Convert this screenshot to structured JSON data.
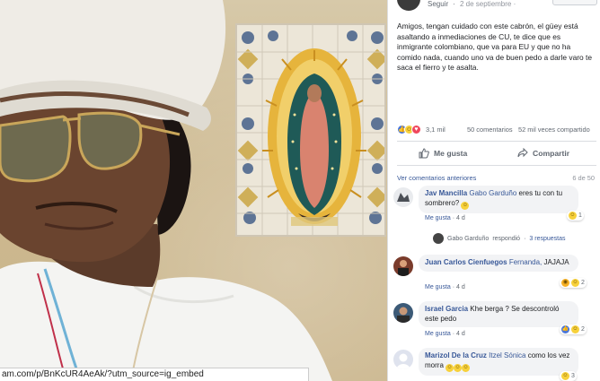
{
  "photo": {
    "url_text": "am.com/p/BnKcUR4AeAk/?utm_source=ig_embed"
  },
  "header": {
    "follow_label": "Seguir",
    "separator": "·",
    "date": "2 de septiembre ·"
  },
  "post": {
    "text": "Amigos, tengan cuidado con este cabrón, el güey está asaltando a inmediaciones de CU, te dice que es inmigrante colombiano, que va para EU y que no ha comido nada, cuando uno va de buen pedo a darle varo te saca el fierro y te asalta."
  },
  "stats": {
    "reactions": "3,1 mil",
    "comments": "50 comentarios",
    "shares": "52 mil veces compartido"
  },
  "actions": {
    "like_label": "Me gusta",
    "share_label": "Compartir"
  },
  "comments_section": {
    "previous_label": "Ver comentarios anteriores",
    "counter": "6 de 50",
    "meta_like": "Me gusta",
    "meta_sep": "·",
    "items": [
      {
        "name": "Jav Mancilla",
        "tag": "Gabo Garduño",
        "text": "eres tu con tu sombrero?",
        "time": "4 d",
        "reaction_count": "1"
      },
      {
        "name": "Juan Carlos Cienfuegos",
        "tag": "Fernanda,",
        "text": "JAJAJA",
        "time": "4 d",
        "reaction_count": "2"
      },
      {
        "name": "Israel Garcia",
        "tag": "",
        "text": "Khe berga ? Se descontroló este pedo",
        "time": "4 d",
        "reaction_count": "2"
      },
      {
        "name": "Marizol De la Cruz",
        "tag": "Itzel Sónica",
        "text": "como los vez morra",
        "time": "",
        "reaction_count": "3"
      }
    ],
    "reply": {
      "author": "Gabo Garduño",
      "verb": "respondió",
      "sep": "·",
      "count": "3 respuestas"
    }
  },
  "colors": {
    "link_blue": "#385898",
    "bubble_gray": "#f2f3f5",
    "meta_gray": "#606770"
  }
}
